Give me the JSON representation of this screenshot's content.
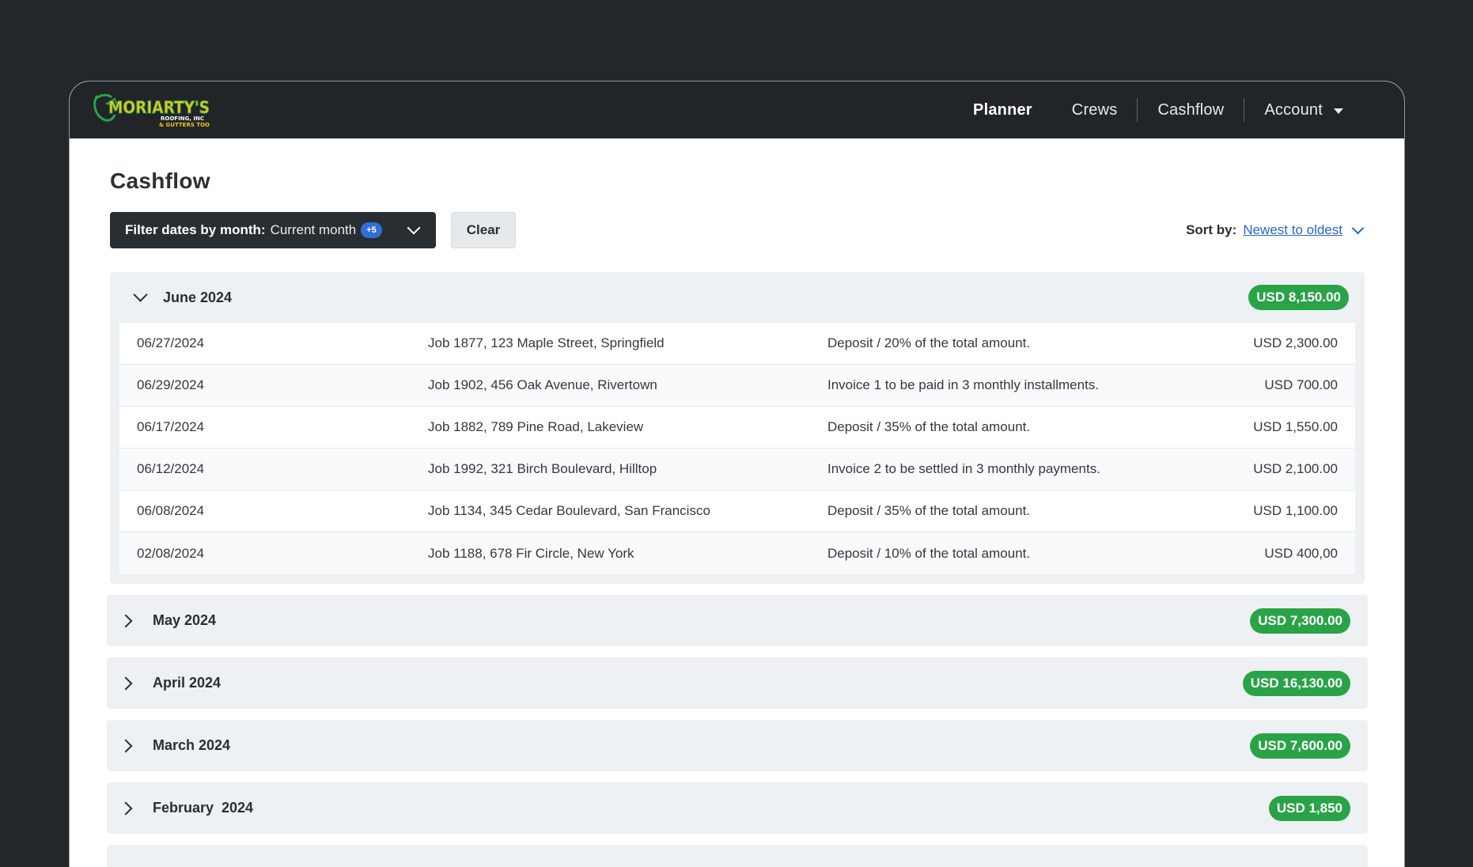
{
  "brand": {
    "logo_name": "MORIARTY'S",
    "logo_sub1": "ROOFING, INC",
    "logo_sub2": "& GUTTERS TOO!"
  },
  "nav": {
    "planner": "Planner",
    "crews": "Crews",
    "cashflow": "Cashflow",
    "account": "Account"
  },
  "page": {
    "title": "Cashflow"
  },
  "filter": {
    "label": "Filter dates by month:",
    "value": "Current month",
    "count_badge": "+5",
    "clear_label": "Clear"
  },
  "sort": {
    "label": "Sort by:",
    "value": "Newest to oldest"
  },
  "groups": [
    {
      "title": "June 2024",
      "total": "USD 8,150.00",
      "expanded": true,
      "rows": [
        {
          "date": "06/27/2024",
          "job": "Job 1877, 123 Maple Street, Springfield",
          "desc": "Deposit / 20% of the total amount.",
          "amount": "USD 2,300.00"
        },
        {
          "date": "06/29/2024",
          "job": "Job 1902, 456 Oak Avenue, Rivertown",
          "desc": "Invoice 1 to be paid in 3 monthly installments.",
          "amount": "USD 700.00"
        },
        {
          "date": "06/17/2024",
          "job": "Job 1882, 789 Pine Road, Lakeview",
          "desc": "Deposit / 35% of the total amount.",
          "amount": "USD 1,550.00"
        },
        {
          "date": "06/12/2024",
          "job": "Job 1992, 321 Birch Boulevard, Hilltop",
          "desc": "Invoice 2 to be settled in 3 monthly payments.",
          "amount": "USD 2,100.00"
        },
        {
          "date": "06/08/2024",
          "job": "Job 1134, 345 Cedar Boulevard, San Francisco",
          "desc": "Deposit / 35% of the total amount.",
          "amount": "USD 1,100.00"
        },
        {
          "date": "02/08/2024",
          "job": "Job 1188, 678 Fir Circle, New York",
          "desc": "Deposit / 10% of the total amount.",
          "amount": "USD 400,00"
        }
      ]
    },
    {
      "title": "May 2024",
      "total": "USD 7,300.00",
      "expanded": false
    },
    {
      "title": "April 2024",
      "total": "USD 16,130.00",
      "expanded": false
    },
    {
      "title": "March 2024",
      "total": "USD 7,600.00",
      "expanded": false
    },
    {
      "title": "February  2024",
      "total": "USD 1,850",
      "expanded": false
    }
  ],
  "colors": {
    "background": "#23272a",
    "topbar": "#212528",
    "accent_blue": "#2a66c9",
    "total_green": "#2aa348",
    "group_bg": "#eef1f3"
  }
}
